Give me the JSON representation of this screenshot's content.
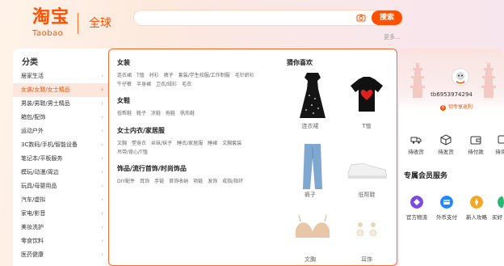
{
  "header": {
    "logo_cn": "淘宝",
    "logo_en": "Taobao",
    "global": "全球",
    "search_placeholder": "",
    "search_button": "搜索",
    "more": "更多..."
  },
  "sidebar": {
    "title": "分类",
    "items": [
      {
        "label": "居家生活"
      },
      {
        "label": "女装/女鞋/女士精品"
      },
      {
        "label": "男装/男鞋/男士精品"
      },
      {
        "label": "箱包/配饰"
      },
      {
        "label": "运动户外"
      },
      {
        "label": "3C数码/手机/智能设备"
      },
      {
        "label": "笔记本/平板服务"
      },
      {
        "label": "模玩/动漫/周边"
      },
      {
        "label": "玩具/母婴用品"
      },
      {
        "label": "汽车/虚拟"
      },
      {
        "label": "家电/影音"
      },
      {
        "label": "美妆洗护"
      },
      {
        "label": "零食饮料"
      },
      {
        "label": "医药健康"
      }
    ]
  },
  "panel": {
    "sections": [
      {
        "title": "女装",
        "links": [
          "连衣裙",
          "T恤",
          "衬衫",
          "裤子",
          "套装/学生校服/工作制服",
          "毛针织衫",
          "牛仔裤",
          "半身裙",
          "卫衣/绒衫",
          "毛衣"
        ]
      },
      {
        "title": "女鞋",
        "links": [
          "低帮鞋",
          "靴子",
          "凉鞋",
          "拖鞋",
          "帆布鞋"
        ]
      },
      {
        "title": "女士内衣/家居服",
        "links": [
          "文胸",
          "塑身衣",
          "丝袜/袜子",
          "睡衣/家居服",
          "睡裙",
          "文胸套装",
          "吊带/背心/T恤"
        ]
      },
      {
        "title": "饰品/流行首饰/时尚饰品",
        "links": [
          "DIY配件",
          "耳饰",
          "手链",
          "首饰收纳",
          "项链",
          "发饰",
          "戒指/指环"
        ]
      }
    ],
    "guess_title": "猜你喜欢",
    "products": [
      {
        "label": "连衣裙"
      },
      {
        "label": "T恤"
      },
      {
        "label": "裤子"
      },
      {
        "label": "低帮鞋"
      },
      {
        "label": "文胸"
      },
      {
        "label": "耳饰"
      }
    ]
  },
  "user": {
    "username": "tb6953974294",
    "badge": "切专享返利",
    "orders": [
      {
        "label": "待收货"
      },
      {
        "label": "待发货"
      },
      {
        "label": "待付款"
      },
      {
        "label": "待评价"
      }
    ],
    "member_title": "专属会员服务",
    "services": [
      {
        "label": "官方物流",
        "color": "#7b4ce0"
      },
      {
        "label": "外币支付",
        "color": "#1e88ff"
      },
      {
        "label": "新人攻略",
        "color": "#f5a623"
      },
      {
        "label": "买好",
        "color": "#2bb673"
      }
    ]
  },
  "colors": {
    "brand": "#ff5000",
    "active_bg": "#fde6dc"
  }
}
